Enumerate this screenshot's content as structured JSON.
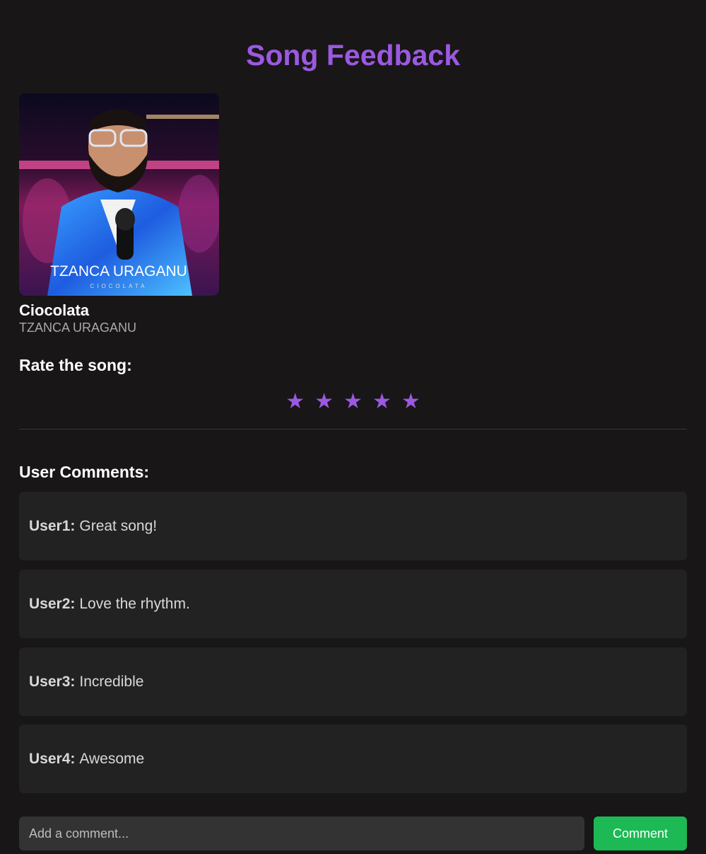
{
  "page_title": "Song Feedback",
  "song": {
    "title": "Ciocolata",
    "artist": "TZANCA URAGANU",
    "cover_text": "TZANCA URAGANU",
    "cover_subtext": "CIOCOLATA"
  },
  "rating": {
    "heading": "Rate the song:",
    "stars": [
      "★",
      "★",
      "★",
      "★",
      "★"
    ],
    "star_color": "#9b59e0"
  },
  "comments": {
    "heading": "User Comments:",
    "items": [
      {
        "user": "User1:",
        "text": "Great song!"
      },
      {
        "user": "User2:",
        "text": "Love the rhythm."
      },
      {
        "user": "User3:",
        "text": "Incredible"
      },
      {
        "user": "User4:",
        "text": "Awesome"
      }
    ]
  },
  "composer": {
    "placeholder": "Add a comment...",
    "value": "",
    "button_label": "Comment"
  },
  "colors": {
    "accent": "#9b59e0",
    "button": "#1db954",
    "background": "#181616",
    "card": "#222222"
  }
}
